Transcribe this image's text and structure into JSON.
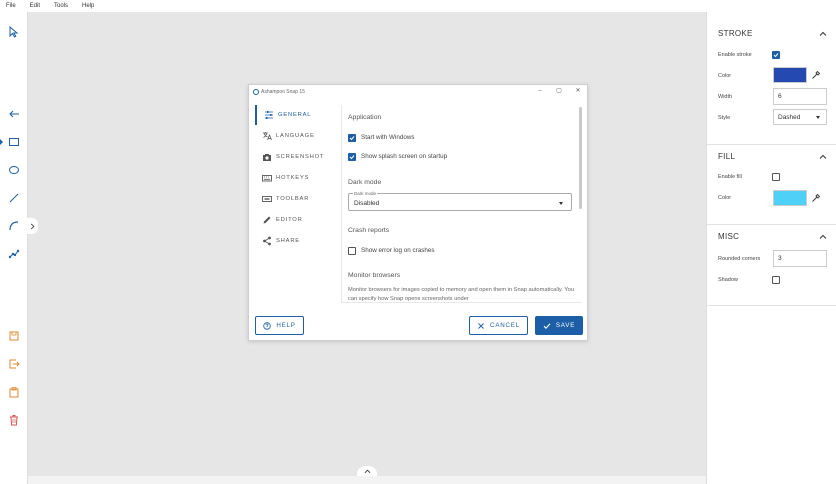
{
  "menu": [
    "File",
    "Edit",
    "Tools",
    "Help"
  ],
  "dialog": {
    "title": "Ashampoo Snap 15",
    "nav": [
      {
        "label": "GENERAL",
        "icon": "sliders-icon"
      },
      {
        "label": "LANGUAGE",
        "icon": "translate-icon"
      },
      {
        "label": "SCREENSHOT",
        "icon": "camera-icon"
      },
      {
        "label": "HOTKEYS",
        "icon": "keyboard-icon"
      },
      {
        "label": "TOOLBAR",
        "icon": "toolbar-icon"
      },
      {
        "label": "EDITOR",
        "icon": "pencil-icon"
      },
      {
        "label": "SHARE",
        "icon": "share-icon"
      }
    ],
    "application_heading": "Application",
    "start_with_windows": "Start with Windows",
    "show_splash": "Show splash screen on startup",
    "dark_mode_heading": "Dark mode",
    "dark_mode_legend": "Dark mode",
    "dark_mode_value": "Disabled",
    "crash_heading": "Crash reports",
    "show_error_log": "Show error log on crashes",
    "monitor_heading": "Monitor browsers",
    "monitor_desc": "Monitor browsers for images copied to memory and open them in Snap automatically. You can specify how Snap opens screenshots under",
    "help_label": "HELP",
    "cancel_label": "CANCEL",
    "save_label": "SAVE"
  },
  "panel": {
    "stroke": {
      "title": "STROKE",
      "enable_label": "Enable stroke",
      "enable_checked": true,
      "color_label": "Color",
      "color": "#2449b0",
      "width_label": "Width",
      "width_value": "6",
      "style_label": "Style",
      "style_value": "Dashed"
    },
    "fill": {
      "title": "FILL",
      "enable_label": "Enable fill",
      "enable_checked": false,
      "color_label": "Color",
      "color": "#4fd0f7"
    },
    "misc": {
      "title": "MISC",
      "rounded_label": "Rounded corners",
      "rounded_value": "3",
      "shadow_label": "Shadow",
      "shadow_checked": false
    }
  },
  "colors": {
    "accent": "#1c5fa8",
    "delete_red": "#d9534f",
    "orange": "#e08a2c"
  }
}
